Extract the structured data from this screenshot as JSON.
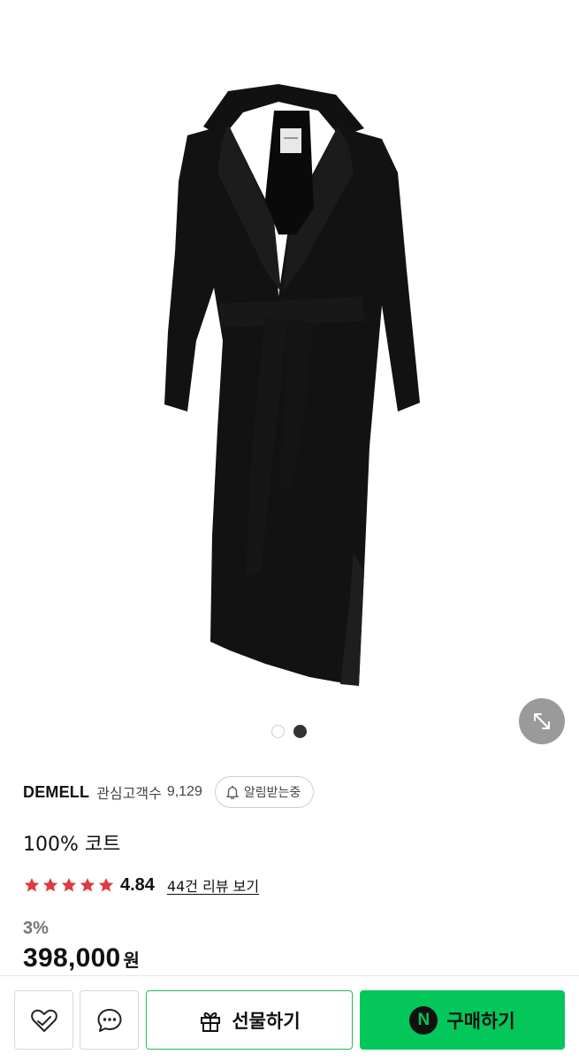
{
  "product": {
    "brand": "DEMELL",
    "fans_label": "관심고객수",
    "fans_count": "9,129",
    "notify_label": "알림받는중",
    "title": "100% 코트",
    "rating_score": "4.84",
    "rating_stars": 5,
    "review_link": "44건 리뷰 보기",
    "discount": "3%",
    "price": "398,000",
    "currency": "원"
  },
  "gallery": {
    "image_count": 2,
    "active_index": 1
  },
  "bottom_bar": {
    "gift_label": "선물하기",
    "buy_label": "구매하기",
    "n_badge": "N"
  },
  "colors": {
    "accent_green": "#03c75a",
    "star_red": "#e0393e"
  }
}
